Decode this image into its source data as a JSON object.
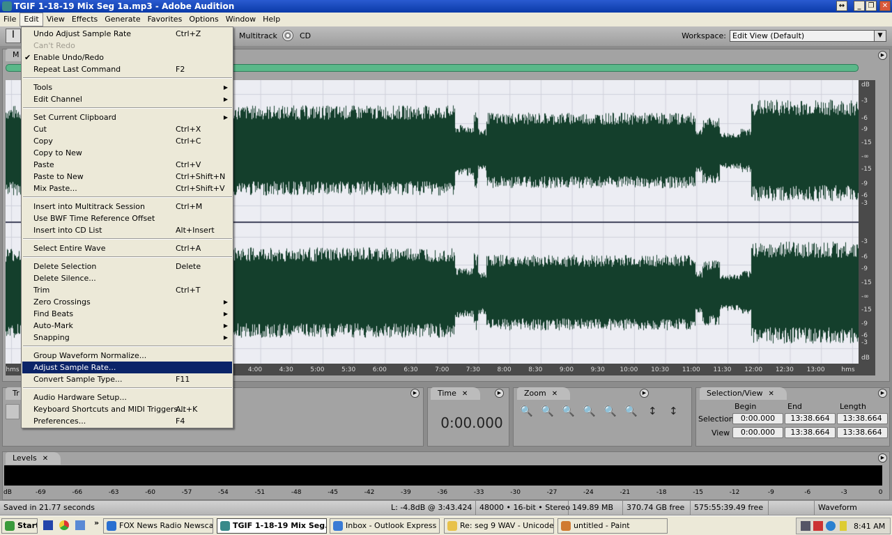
{
  "window": {
    "title": "TGIF 1-18-19 Mix Seg 1a.mp3 - Adobe Audition",
    "controls": [
      "↔",
      "_",
      "❐",
      "✕"
    ]
  },
  "menubar": [
    "File",
    "Edit",
    "View",
    "Effects",
    "Generate",
    "Favorites",
    "Options",
    "Window",
    "Help"
  ],
  "toolbar": {
    "multitrack": "Multitrack",
    "cd": "CD",
    "workspace_label": "Workspace:",
    "workspace_value": "Edit View (Default)"
  },
  "main_tab": "M",
  "edit_menu": [
    {
      "label": "Undo Adjust Sample Rate",
      "shortcut": "Ctrl+Z"
    },
    {
      "label": "Can't Redo",
      "disabled": true
    },
    {
      "label": "Enable Undo/Redo",
      "checked": true
    },
    {
      "label": "Repeat Last Command",
      "shortcut": "F2"
    },
    {
      "sep": true
    },
    {
      "label": "Tools",
      "submenu": true
    },
    {
      "label": "Edit Channel",
      "submenu": true
    },
    {
      "sep": true
    },
    {
      "label": "Set Current Clipboard",
      "submenu": true
    },
    {
      "label": "Cut",
      "shortcut": "Ctrl+X"
    },
    {
      "label": "Copy",
      "shortcut": "Ctrl+C"
    },
    {
      "label": "Copy to New"
    },
    {
      "label": "Paste",
      "shortcut": "Ctrl+V"
    },
    {
      "label": "Paste to New",
      "shortcut": "Ctrl+Shift+N"
    },
    {
      "label": "Mix Paste...",
      "shortcut": "Ctrl+Shift+V"
    },
    {
      "sep": true
    },
    {
      "label": "Insert into Multitrack Session",
      "shortcut": "Ctrl+M"
    },
    {
      "label": "Use BWF Time Reference Offset"
    },
    {
      "label": "Insert into CD List",
      "shortcut": "Alt+Insert"
    },
    {
      "sep": true
    },
    {
      "label": "Select Entire Wave",
      "shortcut": "Ctrl+A"
    },
    {
      "sep": true
    },
    {
      "label": "Delete Selection",
      "shortcut": "Delete"
    },
    {
      "label": "Delete Silence..."
    },
    {
      "label": "Trim",
      "shortcut": "Ctrl+T"
    },
    {
      "label": "Zero Crossings",
      "submenu": true
    },
    {
      "label": "Find Beats",
      "submenu": true
    },
    {
      "label": "Auto-Mark",
      "submenu": true
    },
    {
      "label": "Snapping",
      "submenu": true
    },
    {
      "sep": true
    },
    {
      "label": "Group Waveform Normalize..."
    },
    {
      "label": "Adjust Sample Rate...",
      "highlighted": true
    },
    {
      "label": "Convert Sample Type...",
      "shortcut": "F11"
    },
    {
      "sep": true
    },
    {
      "label": "Audio Hardware Setup..."
    },
    {
      "label": "Keyboard Shortcuts and MIDI Triggers...",
      "shortcut": "Alt+K"
    },
    {
      "label": "Preferences...",
      "shortcut": "F4"
    }
  ],
  "db_ruler": {
    "top": [
      "dB",
      "-3",
      "-6",
      "-9",
      "-15",
      "-∞",
      "-15",
      "-9",
      "-6",
      "-3"
    ],
    "bottom": [
      "-3",
      "-6",
      "-9",
      "-15",
      "-∞",
      "-15",
      "-9",
      "-6",
      "-3",
      "dB"
    ]
  },
  "timeline": {
    "unit": "hms",
    "labels": [
      "4:00",
      "4:30",
      "5:00",
      "5:30",
      "6:00",
      "6:30",
      "7:00",
      "7:30",
      "8:00",
      "8:30",
      "9:00",
      "9:30",
      "10:00",
      "10:30",
      "11:00",
      "11:30",
      "12:00",
      "12:30",
      "13:00"
    ]
  },
  "colors": {
    "waveform": "#143f2c",
    "waveform_bg": "#ecedf3",
    "highlight": "#0b2468"
  },
  "panels": {
    "transport_tab": "Tr",
    "time": {
      "tab": "Time",
      "value": "0:00.000"
    },
    "zoom": {
      "tab": "Zoom",
      "icons": [
        "zoom-in-horizontal-icon",
        "zoom-out-horizontal-icon",
        "zoom-out-full-icon",
        "zoom-to-selection-icon",
        "zoom-left-edge-icon",
        "zoom-right-edge-icon",
        "zoom-in-vertical-icon",
        "zoom-out-vertical-icon"
      ]
    },
    "selection_view": {
      "tab": "Selection/View",
      "headers": [
        "Begin",
        "End",
        "Length"
      ],
      "rows": [
        {
          "label": "Selection",
          "values": [
            "0:00.000",
            "13:38.664",
            "13:38.664"
          ]
        },
        {
          "label": "View",
          "values": [
            "0:00.000",
            "13:38.664",
            "13:38.664"
          ]
        }
      ]
    },
    "levels": {
      "tab": "Levels",
      "scale": [
        "dB",
        "-69",
        "-66",
        "-63",
        "-60",
        "-57",
        "-54",
        "-51",
        "-48",
        "-45",
        "-42",
        "-39",
        "-36",
        "-33",
        "-30",
        "-27",
        "-24",
        "-21",
        "-18",
        "-15",
        "-12",
        "-9",
        "-6",
        "-3",
        "0"
      ]
    }
  },
  "status": {
    "message": "Saved in 21.77 seconds",
    "level": "L: -4.8dB @  3:43.424",
    "format": "48000 • 16-bit • Stereo",
    "size": "149.89 MB",
    "disk": "370.74 GB free",
    "time_free": "575:55:39.49 free",
    "view": "Waveform"
  },
  "taskbar": {
    "start": "Start",
    "more": "»",
    "items": [
      {
        "label": "FOX News Radio Newsca...",
        "color": "#2a70d0"
      },
      {
        "label": "TGIF 1-18-19 Mix Seg...",
        "active": true,
        "color": "#3a8a8a"
      },
      {
        "label": "Inbox - Outlook Express",
        "color": "#3a7bd5"
      },
      {
        "label": "Re: seg 9 WAV - Unicode...",
        "color": "#e8c24a"
      },
      {
        "label": "untitled - Paint",
        "color": "#d07a30"
      }
    ],
    "clock": "8:41 AM"
  }
}
